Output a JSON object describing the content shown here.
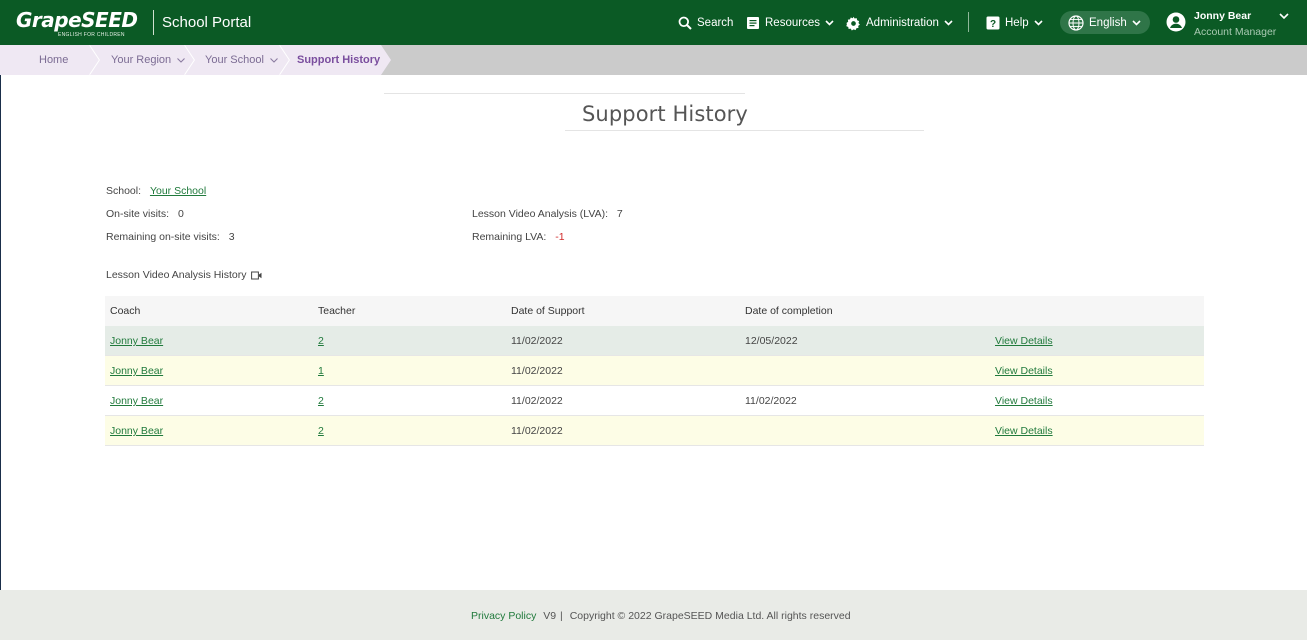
{
  "header": {
    "logo_text": "GrapeSEED",
    "logo_subtitle": "ENGLISH FOR CHILDREN",
    "portal_title": "School Portal",
    "nav": {
      "search": "Search",
      "resources": "Resources",
      "administration": "Administration",
      "help": "Help",
      "language": "English"
    },
    "user": {
      "name": "Jonny Bear",
      "role": "Account Manager"
    }
  },
  "breadcrumb": {
    "home": "Home",
    "region": "Your Region",
    "school": "Your School",
    "current": "Support History"
  },
  "page": {
    "title": "Support History"
  },
  "info": {
    "school_label": "School:",
    "school_value": "Your School",
    "onsite_label": "On-site visits:",
    "onsite_value": "0",
    "remaining_onsite_label": "Remaining on-site visits:",
    "remaining_onsite_value": "3",
    "lva_label": "Lesson Video Analysis (LVA):",
    "lva_value": "7",
    "remaining_lva_label": "Remaining LVA:",
    "remaining_lva_value": "-1"
  },
  "history": {
    "heading": "Lesson Video Analysis History",
    "columns": {
      "coach": "Coach",
      "teacher": "Teacher",
      "date_of_support": "Date of Support",
      "date_of_completion": "Date of completion"
    },
    "rows": [
      {
        "coach": "Jonny Bear",
        "teacher": "2",
        "date_of_support": "11/02/2022",
        "date_of_completion": "12/05/2022",
        "action": "View Details"
      },
      {
        "coach": "Jonny Bear",
        "teacher": "1",
        "date_of_support": "11/02/2022",
        "date_of_completion": "",
        "action": "View Details"
      },
      {
        "coach": "Jonny Bear",
        "teacher": "2",
        "date_of_support": "11/02/2022",
        "date_of_completion": "11/02/2022",
        "action": "View Details"
      },
      {
        "coach": "Jonny Bear",
        "teacher": "2",
        "date_of_support": "11/02/2022",
        "date_of_completion": "",
        "action": "View Details"
      }
    ]
  },
  "footer": {
    "privacy": "Privacy Policy",
    "version": "V9",
    "separator": "|",
    "copyright": "Copyright © 2022 GrapeSEED Media Ltd. All rights reserved"
  },
  "colors": {
    "header_bg": "#0b5a25",
    "link": "#207a3c",
    "breadcrumb_active": "#7a4e9e",
    "negative": "#d12a2a"
  },
  "icons": {
    "search": "search-icon",
    "resources": "document-icon",
    "administration": "gear-icon",
    "help": "question-icon",
    "language": "globe-icon",
    "user": "user-avatar-icon",
    "video": "video-camera-icon"
  }
}
